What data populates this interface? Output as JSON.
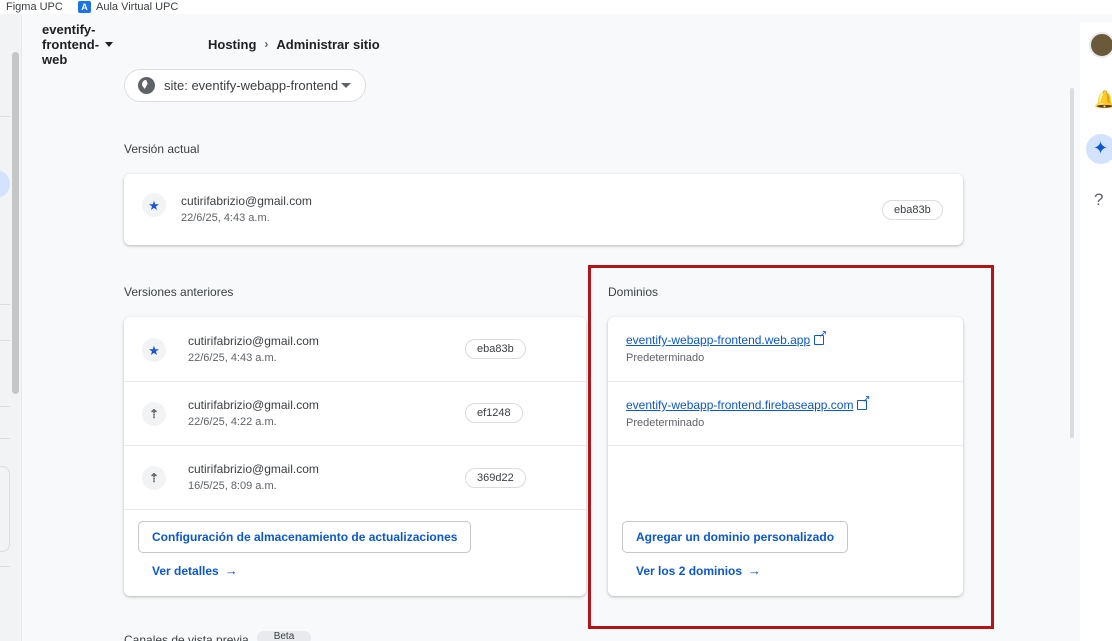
{
  "bookmarks": [
    {
      "label": "Figma UPC"
    },
    {
      "label": "Aula Virtual UPC",
      "icon": "A"
    }
  ],
  "header": {
    "project": "eventify-frontend-web",
    "breadcrumb": [
      "Hosting",
      "Administrar sitio"
    ],
    "separator": "›"
  },
  "site_select": {
    "label": "site: eventify-webapp-frontend"
  },
  "current_version": {
    "title": "Versión actual",
    "email": "cutirifabrizio@gmail.com",
    "date": "22/6/25, 4:43 a.m.",
    "hash": "eba83b"
  },
  "previous_versions": {
    "title": "Versiones anteriores",
    "rows": [
      {
        "email": "cutirifabrizio@gmail.com",
        "date": "22/6/25, 4:43 a.m.",
        "hash": "eba83b",
        "icon": "star-icon"
      },
      {
        "email": "cutirifabrizio@gmail.com",
        "date": "22/6/25, 4:22 a.m.",
        "hash": "ef1248",
        "icon": "upload-icon"
      },
      {
        "email": "cutirifabrizio@gmail.com",
        "date": "16/5/25, 8:09 a.m.",
        "hash": "369d22",
        "icon": "upload-icon"
      }
    ],
    "config_button": "Configuración de almacenamiento de actualizaciones",
    "details_link": "Ver detalles"
  },
  "domains": {
    "title": "Dominios",
    "items": [
      {
        "url": "eventify-webapp-frontend.web.app",
        "label": "Predeterminado"
      },
      {
        "url": "eventify-webapp-frontend.firebaseapp.com",
        "label": "Predeterminado"
      }
    ],
    "add_button": "Agregar un dominio personalizado",
    "view_all_link": "Ver los 2 dominios"
  },
  "bottom": {
    "title": "Canales de vista previa",
    "badge": "Beta"
  },
  "colors": {
    "accent": "#0b57d0",
    "highlight": "#b3141a",
    "star": "#1a56db"
  }
}
